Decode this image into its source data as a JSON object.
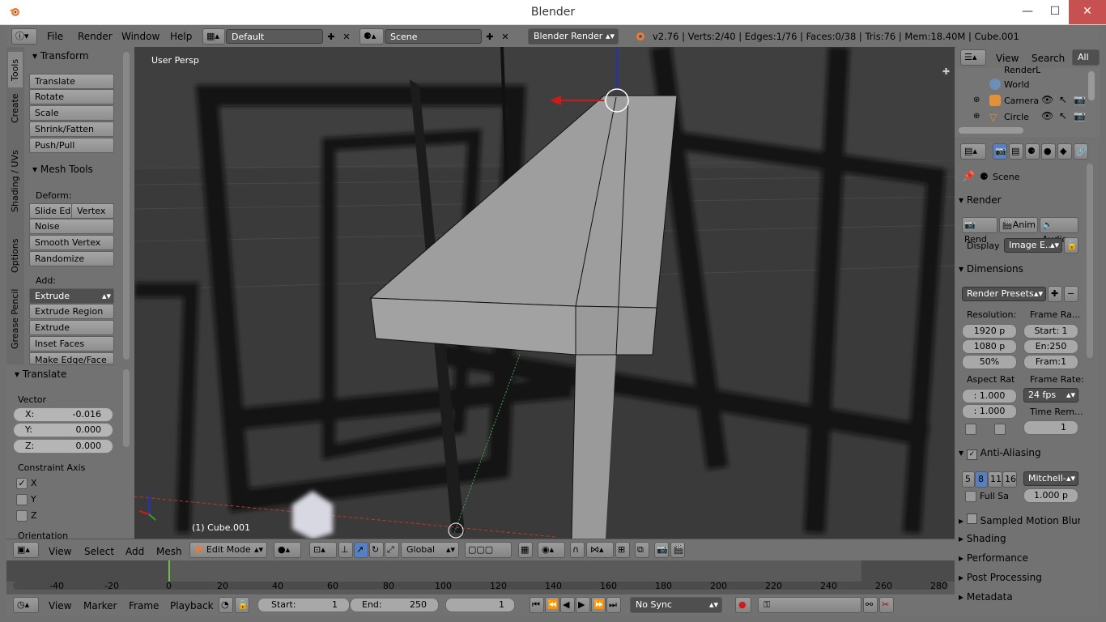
{
  "window": {
    "title": "Blender",
    "min": "—",
    "max": "☐",
    "close": "✕"
  },
  "infobar": {
    "menus": [
      "File",
      "Render",
      "Window",
      "Help"
    ],
    "layout": "Default",
    "scene": "Scene",
    "engine": "Blender Render",
    "stats": "v2.76 | Verts:2/40 | Edges:1/76 | Faces:0/38 | Tris:76 | Mem:18.40M | Cube.001"
  },
  "tabs": [
    "Tools",
    "Create",
    "Shading / UVs",
    "Options",
    "Grease Pencil"
  ],
  "toolshelf": {
    "transform_title": "Transform",
    "transform_buttons": [
      "Translate",
      "Rotate",
      "Scale",
      "Shrink/Fatten",
      "Push/Pull"
    ],
    "mesh_tools_title": "Mesh Tools",
    "deform_label": "Deform:",
    "slide_edge": "Slide Ed",
    "vertex": "Vertex",
    "deform_buttons": [
      "Noise",
      "Smooth Vertex",
      "Randomize"
    ],
    "add_label": "Add:",
    "extrude": "Extrude",
    "add_buttons": [
      "Extrude Region",
      "Extrude Individual",
      "Inset Faces",
      "Make Edge/Face"
    ]
  },
  "redo": {
    "title": "Translate",
    "vector_label": "Vector",
    "x": {
      "label": "X:",
      "value": "-0.016"
    },
    "y": {
      "label": "Y:",
      "value": "0.000"
    },
    "z": {
      "label": "Z:",
      "value": "0.000"
    },
    "constraint_label": "Constraint Axis",
    "axes": [
      {
        "label": "X",
        "checked": true
      },
      {
        "label": "Y",
        "checked": false
      },
      {
        "label": "Z",
        "checked": false
      }
    ],
    "orientation_label": "Orientation"
  },
  "viewport": {
    "view_label": "User Persp",
    "object_label": "(1) Cube.001"
  },
  "viewhdr": {
    "menus": [
      "View",
      "Select",
      "Add",
      "Mesh"
    ],
    "mode": "Edit Mode",
    "orientation": "Global"
  },
  "timeline": {
    "ticks": [
      "-40",
      "-20",
      "0",
      "20",
      "40",
      "60",
      "80",
      "100",
      "120",
      "140",
      "160",
      "180",
      "200",
      "220",
      "240",
      "260",
      "280"
    ]
  },
  "timehdr": {
    "menus": [
      "View",
      "Marker",
      "Frame",
      "Playback"
    ],
    "start_label": "Start:",
    "start_value": "1",
    "end_label": "End:",
    "end_value": "250",
    "current": "1",
    "sync": "No Sync"
  },
  "outliner": {
    "menus": [
      "View",
      "Search"
    ],
    "filter": "All Sc",
    "items": [
      "RenderL",
      "World",
      "Camera",
      "Circle"
    ]
  },
  "props": {
    "context": "Scene",
    "render_title": "Render",
    "render_btn": "Rend",
    "anim_btn": "Anim",
    "audio_btn": "Audio",
    "display_label": "Display",
    "display_value": "Image E...",
    "dimensions_title": "Dimensions",
    "presets": "Render Presets",
    "resolution_label": "Resolution:",
    "res_x": "1920 p",
    "res_y": "1080 p",
    "res_pct": "50%",
    "frame_range_label": "Frame Ra...",
    "frame_start": "Start: 1",
    "frame_end": "En:250",
    "frame_step": "Fram:1",
    "aspect_label": "Aspect Rat",
    "aspect_x": ": 1.000",
    "aspect_y": ": 1.000",
    "frame_rate_label": "Frame Rate:",
    "fps": "24 fps",
    "time_remap_label": "Time Rem...",
    "time_remap_value": "1",
    "aa_title": "Anti-Aliasing",
    "aa_samples": [
      "5",
      "8",
      "11",
      "16"
    ],
    "aa_filter": "Mitchell-",
    "full_sample": "Full Sa",
    "filter_size": "1.000 p",
    "collapsed": [
      "Sampled Motion Blur",
      "Shading",
      "Performance",
      "Post Processing",
      "Metadata"
    ]
  }
}
